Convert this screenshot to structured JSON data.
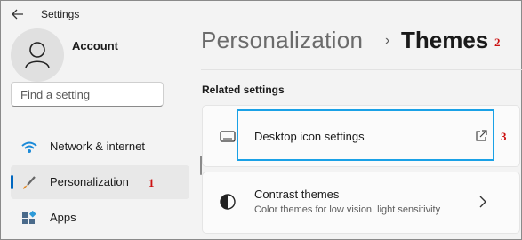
{
  "window": {
    "title": "Settings"
  },
  "account": {
    "name": "Account"
  },
  "search": {
    "placeholder": "Find a setting"
  },
  "sidebar": {
    "items": [
      {
        "label": "Network & internet",
        "icon": "wifi-icon",
        "active": false
      },
      {
        "label": "Personalization",
        "icon": "brush-icon",
        "active": true,
        "step": "1"
      },
      {
        "label": "Apps",
        "icon": "apps-icon",
        "active": false
      }
    ]
  },
  "breadcrumb": {
    "parent": "Personalization",
    "separator": "›",
    "current": "Themes",
    "step": "2"
  },
  "related": {
    "heading": "Related settings",
    "items": [
      {
        "title": "Desktop icon settings",
        "icon": "monitor-icon",
        "action_icon": "open-external-icon",
        "step": "3"
      },
      {
        "title": "Contrast themes",
        "subtitle": "Color themes for low vision, light sensitivity",
        "icon": "contrast-icon",
        "action_icon": "chevron-right-icon"
      }
    ]
  },
  "colors": {
    "accent": "#0067c0",
    "highlight_box": "#1aa1e6",
    "annotation": "#cc1111"
  }
}
